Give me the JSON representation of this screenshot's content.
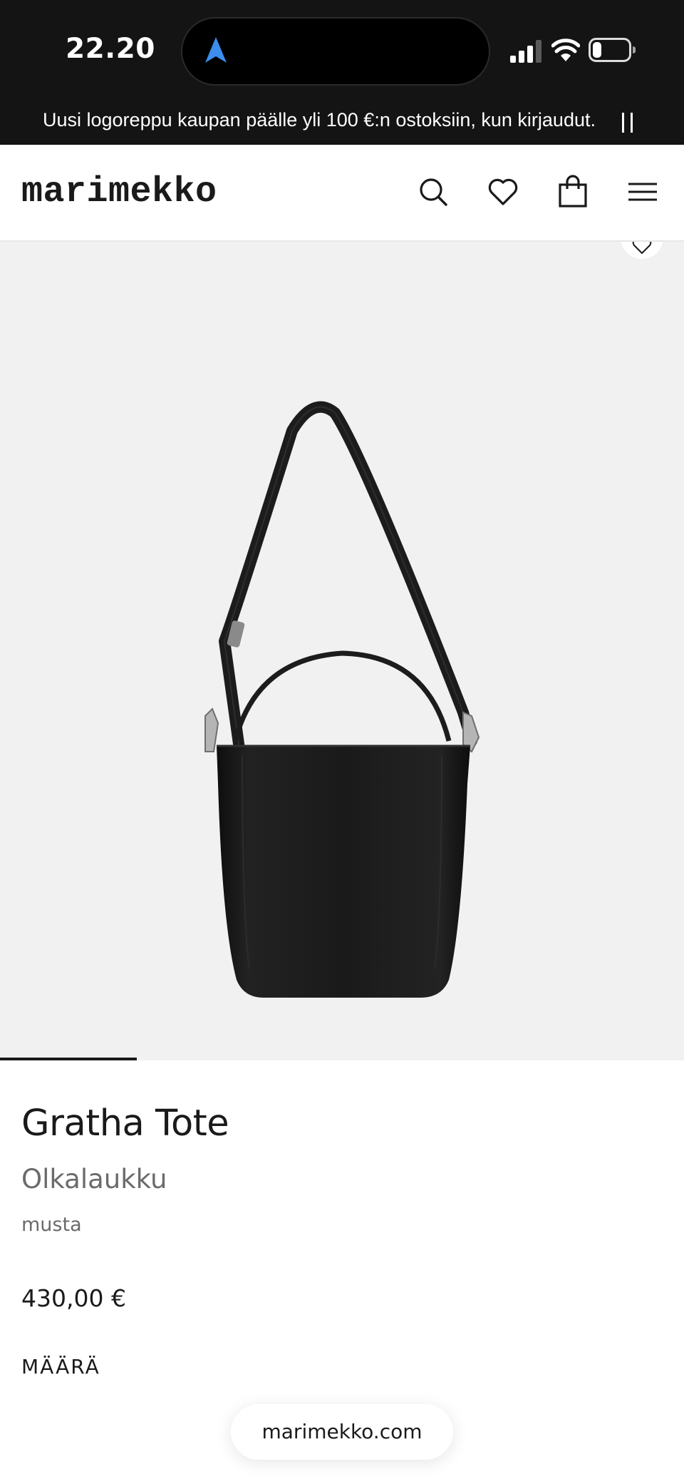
{
  "status_bar": {
    "time": "22.20",
    "icons": [
      "location-arrow-icon",
      "cellular-signal-icon",
      "wifi-icon",
      "battery-icon"
    ],
    "location_color": "#3b8eed"
  },
  "promo_banner": {
    "text": "Uusi logoreppu kaupan päälle yli 100 €:n ostoksiin, kun kirjaudut.",
    "pause_icon": "pause-icon",
    "background": "#141414"
  },
  "header": {
    "logo": "marimekko",
    "icons": [
      "search-icon",
      "heart-icon",
      "shopping-bag-icon",
      "hamburger-menu-icon"
    ]
  },
  "gallery": {
    "favorite_icon": "heart-icon",
    "image_description_icon": "black-tote-bag",
    "progress_fraction": 0.2
  },
  "product": {
    "name": "Gratha Tote",
    "category": "Olkalaukku",
    "color": "musta",
    "price": "430,00 €",
    "quantity_label": "MÄÄRÄ"
  },
  "browser": {
    "url": "marimekko.com"
  }
}
